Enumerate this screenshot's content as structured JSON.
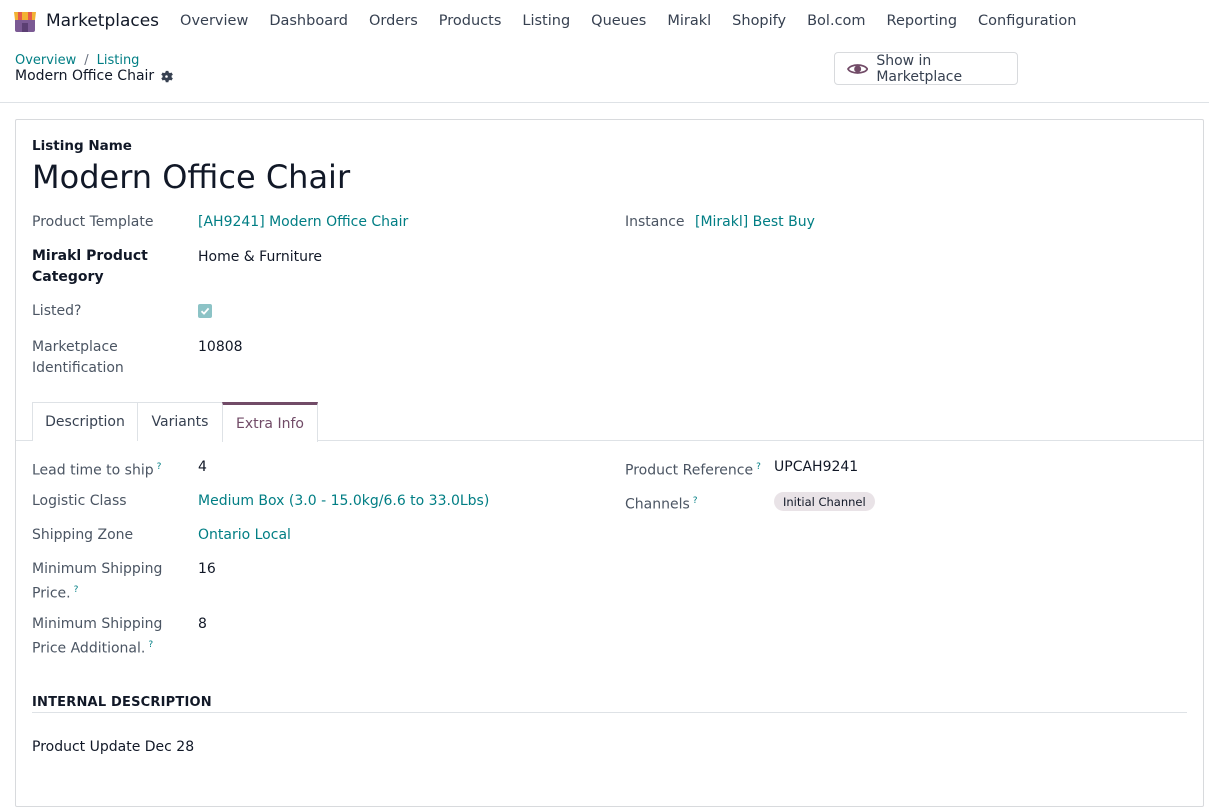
{
  "navbar": {
    "app_name": "Marketplaces",
    "menu": [
      "Overview",
      "Dashboard",
      "Orders",
      "Products",
      "Listing",
      "Queues",
      "Mirakl",
      "Shopify",
      "Bol.com",
      "Reporting",
      "Configuration"
    ]
  },
  "breadcrumb": {
    "items": [
      "Overview",
      "Listing"
    ],
    "separator": "/",
    "current": "Modern Office Chair"
  },
  "actions": {
    "show_in_marketplace": "Show in Marketplace"
  },
  "form": {
    "listing_name_label": "Listing Name",
    "listing_name": "Modern Office Chair",
    "product_template_label": "Product Template",
    "product_template": "[AH9241] Modern Office Chair",
    "instance_label": "Instance",
    "instance": "[Mirakl] Best Buy",
    "mirakl_category_label_1": "Mirakl Product",
    "mirakl_category_label_2": "Category",
    "mirakl_category": "Home & Furniture",
    "listed_label": "Listed?",
    "listed": true,
    "marketplace_id_label_1": "Marketplace",
    "marketplace_id_label_2": "Identification",
    "marketplace_id": "10808"
  },
  "tabs": {
    "items": [
      "Description",
      "Variants",
      "Extra Info"
    ],
    "active": "Extra Info"
  },
  "extra_info": {
    "lead_time_label": "Lead time to ship",
    "lead_time": "4",
    "logistic_class_label": "Logistic Class",
    "logistic_class": "Medium Box (3.0 - 15.0kg/6.6 to 33.0Lbs)",
    "shipping_zone_label": "Shipping Zone",
    "shipping_zone": "Ontario Local",
    "min_ship_price_label_1": "Minimum Shipping",
    "min_ship_price_label_2": "Price.",
    "min_ship_price": "16",
    "min_ship_price_add_label_1": "Minimum Shipping",
    "min_ship_price_add_label_2": "Price Additional.",
    "min_ship_price_add": "8",
    "product_reference_label": "Product Reference",
    "product_reference": "UPCAH9241",
    "channels_label": "Channels",
    "channels": [
      "Initial Channel"
    ],
    "help_mark": "?",
    "internal_description_title": "INTERNAL DESCRIPTION",
    "internal_description": "Product Update Dec 28"
  },
  "colors": {
    "accent": "#714b67",
    "link": "#017e84",
    "checkbox": "#8cc3c6",
    "badge_bg": "#e9e3e7"
  }
}
